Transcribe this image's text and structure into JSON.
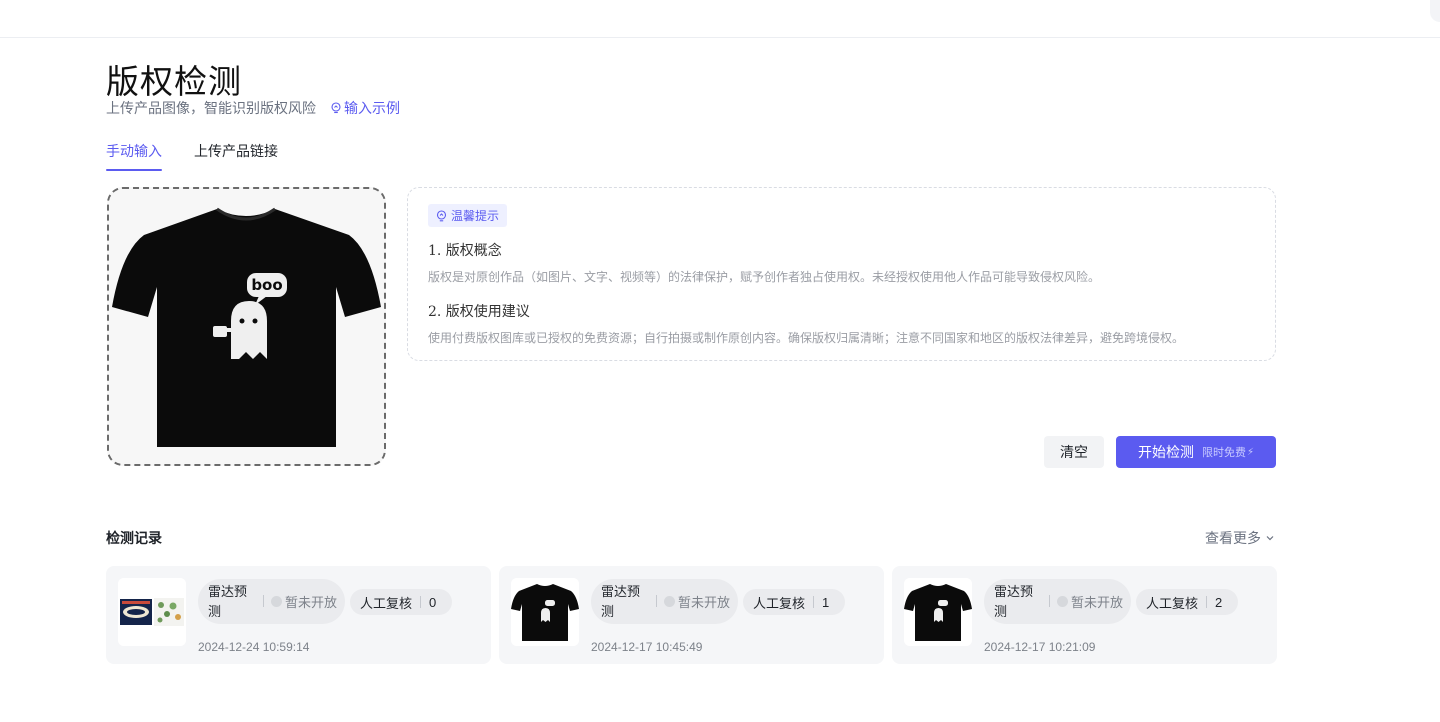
{
  "header": {
    "title": "版权检测",
    "subtitle": "上传产品图像，智能识别版权风险",
    "example_link": "输入示例"
  },
  "tabs": [
    {
      "label": "手动输入",
      "active": true
    },
    {
      "label": "上传产品链接",
      "active": false
    }
  ],
  "upload": {
    "image": "black-tshirt-boo-ghost",
    "shirt_text": "boo"
  },
  "tips": {
    "badge": "温馨提示",
    "items": [
      {
        "title": "1. 版权概念",
        "text": "版权是对原创作品（如图片、文字、视频等）的法律保护，赋予创作者独占使用权。未经授权使用他人作品可能导致侵权风险。"
      },
      {
        "title": "2. 版权使用建议",
        "text": "使用付费版权图库或已授权的免费资源；自行拍摄或制作原创内容。确保版权归属清晰；注意不同国家和地区的版权法律差异，避免跨境侵权。"
      }
    ]
  },
  "actions": {
    "clear": "清空",
    "start": "开始检测",
    "start_badge": "限时免费",
    "start_badge_icon": "lightning-icon"
  },
  "records": {
    "title": "检测记录",
    "more": "查看更多",
    "items": [
      {
        "thumb": "poster-thumbnail",
        "radar_label": "雷达预测",
        "radar_status": "暂未开放",
        "manual_label": "人工复核",
        "manual_count": "0",
        "time": "2024-12-24 10:59:14"
      },
      {
        "thumb": "black-tshirt-thumbnail",
        "radar_label": "雷达预测",
        "radar_status": "暂未开放",
        "manual_label": "人工复核",
        "manual_count": "1",
        "time": "2024-12-17 10:45:49"
      },
      {
        "thumb": "black-tshirt-thumbnail",
        "radar_label": "雷达预测",
        "radar_status": "暂未开放",
        "manual_label": "人工复核",
        "manual_count": "2",
        "time": "2024-12-17 10:21:09"
      }
    ]
  },
  "colors": {
    "accent": "#5b5bf0",
    "card_bg": "#f5f6f8",
    "pill_bg": "#eaebee"
  }
}
